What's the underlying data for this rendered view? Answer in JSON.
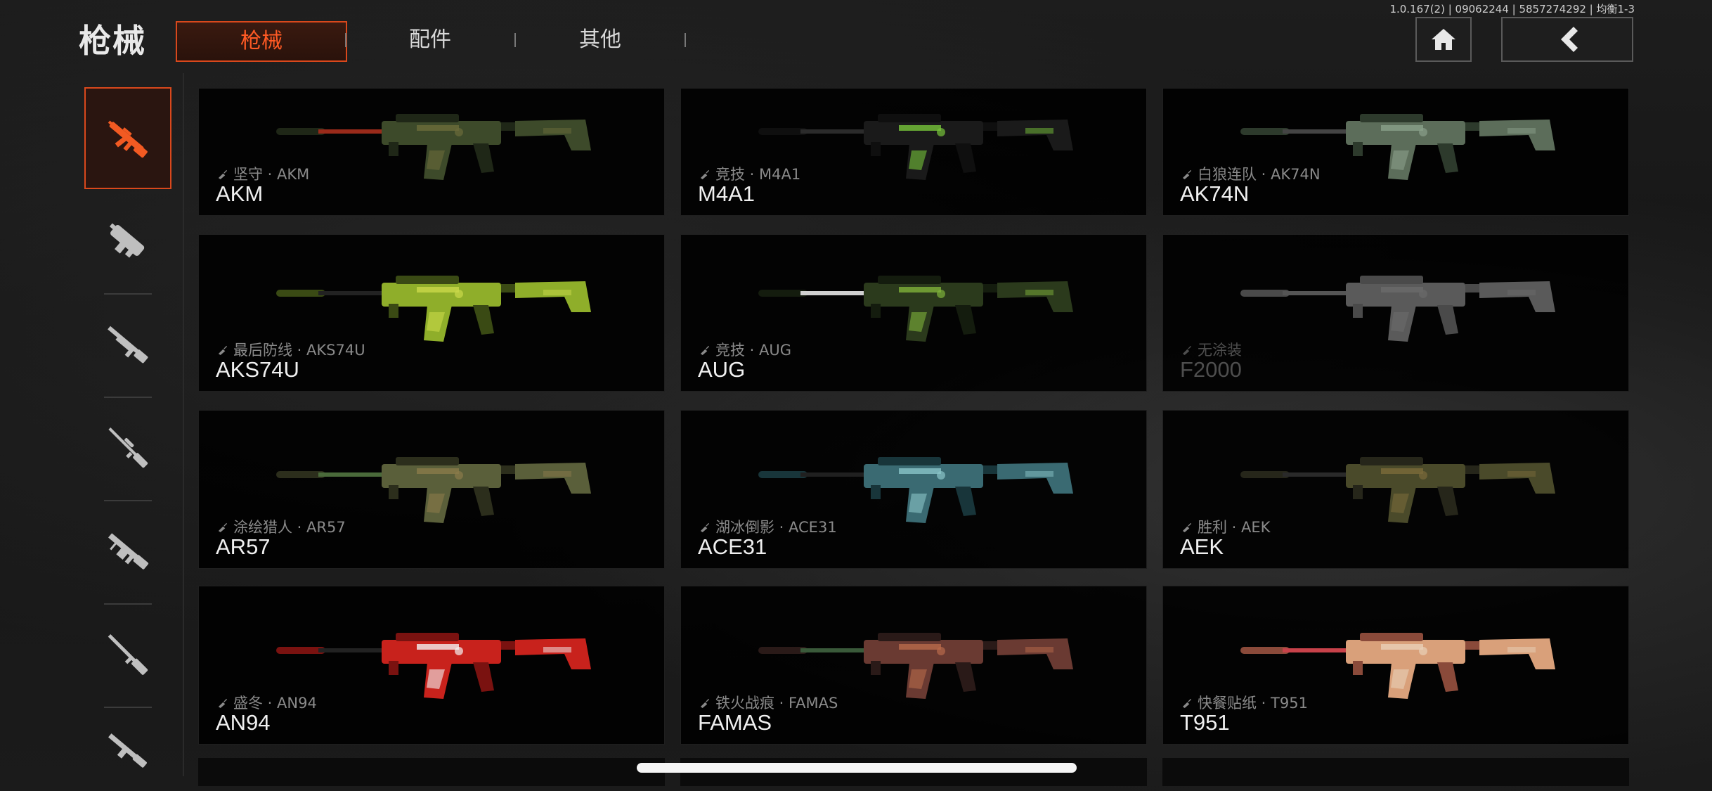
{
  "header": {
    "title": "枪械",
    "tabs": [
      {
        "label": "枪械",
        "active": true
      },
      {
        "label": "配件",
        "active": false
      },
      {
        "label": "其他",
        "active": false
      }
    ],
    "version": "1.0.167(2) | 09062244 | 5857274292 | 均衡1-3",
    "home_icon": "home-icon",
    "back_icon": "back-arrow-icon"
  },
  "sidebar": {
    "items": [
      {
        "icon": "assault-rifle-icon",
        "active": true
      },
      {
        "icon": "smg-icon",
        "active": false
      },
      {
        "icon": "shotgun-icon",
        "active": false
      },
      {
        "icon": "sniper-rifle-icon",
        "active": false
      },
      {
        "icon": "lmg-icon",
        "active": false
      },
      {
        "icon": "marksman-rifle-icon",
        "active": false
      },
      {
        "icon": "pistol-icon",
        "active": false
      }
    ]
  },
  "colors": {
    "accent": "#d9481c",
    "accent_text": "#ff5a24",
    "card_bg": "#000000"
  },
  "weapons": [
    {
      "skin": "坚守 · AKM",
      "name": "AKM",
      "locked": false,
      "palette": [
        "#3d4a2a",
        "#1f2717",
        "#6b6b3a",
        "#9a2a1a"
      ]
    },
    {
      "skin": "竞技 · M4A1",
      "name": "M4A1",
      "locked": false,
      "palette": [
        "#1a1a1a",
        "#0f0f0f",
        "#77c43a",
        "#2b2b2b"
      ]
    },
    {
      "skin": "白狼连队 · AK74N",
      "name": "AK74N",
      "locked": false,
      "palette": [
        "#5c6d5a",
        "#2d3a2c",
        "#8aa08a",
        "#444444"
      ]
    },
    {
      "skin": "最后防线 · AKS74U",
      "name": "AKS74U",
      "locked": false,
      "palette": [
        "#8fae2a",
        "#3a4a14",
        "#c9d84a",
        "#222222"
      ]
    },
    {
      "skin": "竞技 · AUG",
      "name": "AUG",
      "locked": false,
      "palette": [
        "#2b3a1c",
        "#141c0e",
        "#7fb23a",
        "#d0d0d0"
      ]
    },
    {
      "skin": "无涂装",
      "name": "F2000",
      "locked": true,
      "palette": [
        "#5a5a5a",
        "#4a4a4a",
        "#6a6a6a",
        "#555555"
      ]
    },
    {
      "skin": "涂绘猎人 · AR57",
      "name": "AR57",
      "locked": false,
      "palette": [
        "#5a5f3a",
        "#2c2e1c",
        "#8a7a4a",
        "#4a6a3a"
      ]
    },
    {
      "skin": "湖冰倒影 · ACE31",
      "name": "ACE31",
      "locked": false,
      "palette": [
        "#3a6a72",
        "#18353a",
        "#8ac4c8",
        "#202020"
      ]
    },
    {
      "skin": "胜利 · AEK",
      "name": "AEK",
      "locked": false,
      "palette": [
        "#4a4a2a",
        "#26261a",
        "#7a6a3a",
        "#2a2a2a"
      ]
    },
    {
      "skin": "盛冬 · AN94",
      "name": "AN94",
      "locked": false,
      "palette": [
        "#c8221c",
        "#7a1210",
        "#f2f2f2",
        "#222222"
      ]
    },
    {
      "skin": "铁火战痕 · FAMAS",
      "name": "FAMAS",
      "locked": false,
      "palette": [
        "#6a3a32",
        "#2a1a18",
        "#b86a4a",
        "#3a5a3a"
      ]
    },
    {
      "skin": "快餐贴纸 · T951",
      "name": "T951",
      "locked": false,
      "palette": [
        "#d9a07a",
        "#8a4a3a",
        "#e8d0b8",
        "#c8424a"
      ]
    }
  ]
}
